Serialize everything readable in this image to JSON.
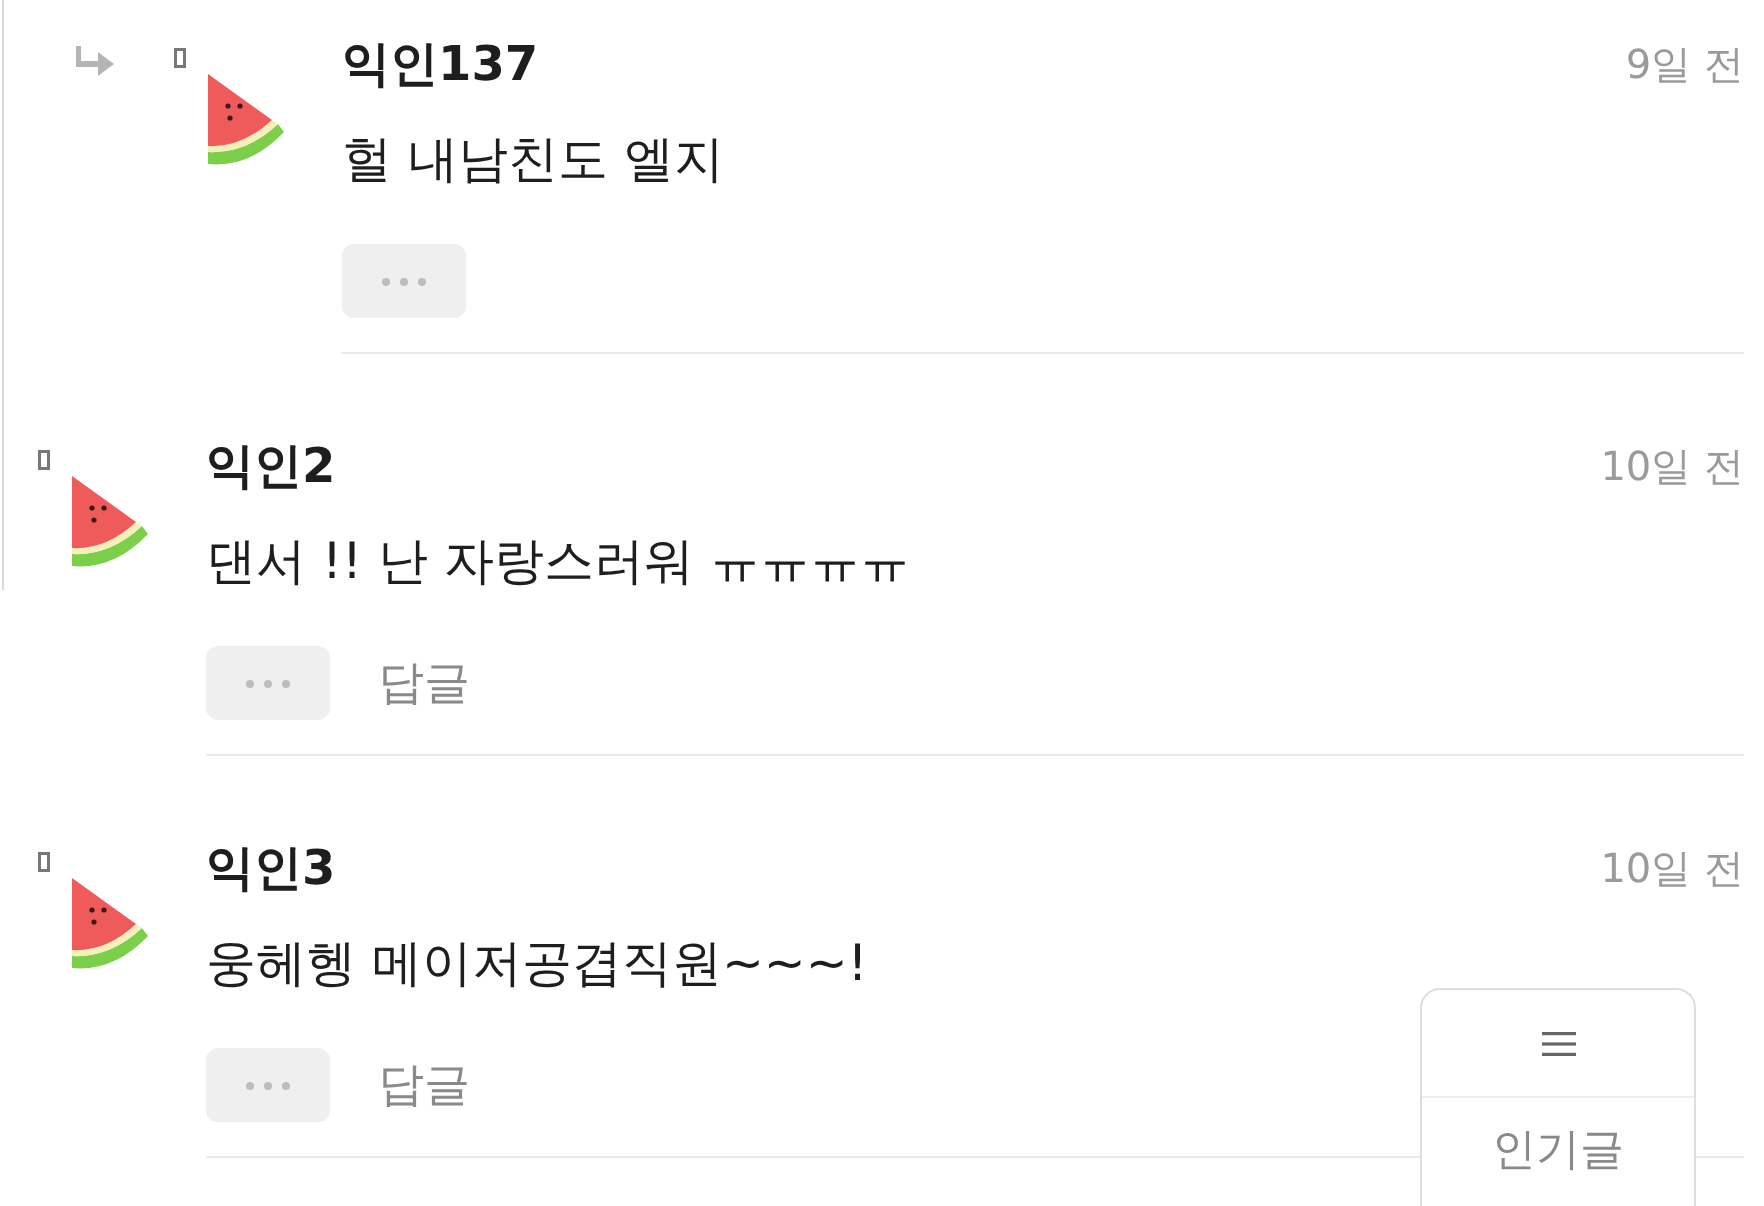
{
  "comments": [
    {
      "kind": "reply",
      "author": "익인137",
      "time": "9일 전",
      "body": "헐 내남친도 엘지"
    },
    {
      "kind": "comment",
      "author": "익인2",
      "time": "10일 전",
      "body": "댄서 !! 난 자랑스러워 ㅠㅠㅠㅠ",
      "reply_label": "답글"
    },
    {
      "kind": "comment",
      "author": "익인3",
      "time": "10일 전",
      "body": "웅헤헹 메이저공겹직원~~~!",
      "reply_label": "답글"
    }
  ],
  "floating_menu": {
    "label": "인기글"
  }
}
